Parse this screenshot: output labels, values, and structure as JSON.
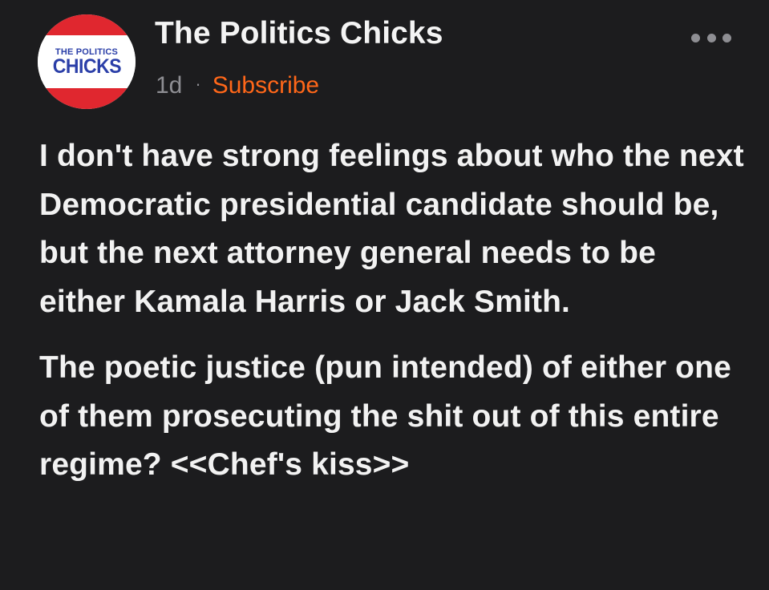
{
  "post": {
    "author": "The Politics Chicks",
    "avatar": {
      "logo_top": "THE POLITICS",
      "logo_bottom": "CHICKS",
      "colors": {
        "band": "#e0272f",
        "text": "#2b3fa8",
        "center": "#ffffff"
      }
    },
    "time": "1d",
    "separator": "·",
    "subscribe_label": "Subscribe",
    "more_icon": "more-horizontal-icon",
    "paragraphs": [
      "I don't have strong feelings about who the next Democratic presidential candidate should be, but the next attorney general needs to be either Kamala Harris or Jack Smith.",
      "The poetic justice (pun intended) of either one of them prosecuting the shit out of this entire regime? <<Chef's kiss>>"
    ]
  },
  "colors": {
    "background": "#1c1c1e",
    "accent": "#ff6719",
    "secondary_text": "#8e8e93"
  }
}
